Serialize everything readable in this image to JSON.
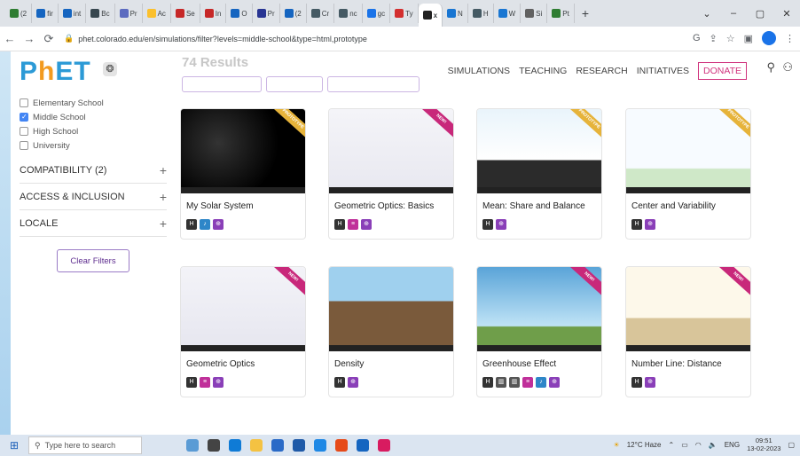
{
  "browser": {
    "tabs": [
      {
        "label": "(2",
        "color": "#2e7d32"
      },
      {
        "label": "fir",
        "color": "#1565c0"
      },
      {
        "label": "int",
        "color": "#1565c0"
      },
      {
        "label": "Bc",
        "color": "#37474f"
      },
      {
        "label": "Pr",
        "color": "#5c6bc0"
      },
      {
        "label": "Ac",
        "color": "#fbc02d"
      },
      {
        "label": "Se",
        "color": "#c62828"
      },
      {
        "label": "In",
        "color": "#c62828"
      },
      {
        "label": "O",
        "color": "#1565c0"
      },
      {
        "label": "Pr",
        "color": "#283593"
      },
      {
        "label": "(2",
        "color": "#1565c0"
      },
      {
        "label": "Cr",
        "color": "#455a64"
      },
      {
        "label": "nc",
        "color": "#455a64"
      },
      {
        "label": "gc",
        "color": "#1a73e8"
      },
      {
        "label": "Ty",
        "color": "#d32f2f"
      },
      {
        "label": "x",
        "color": "#212121",
        "active": true
      },
      {
        "label": "N",
        "color": "#1976d2"
      },
      {
        "label": "H",
        "color": "#455a64"
      },
      {
        "label": "W",
        "color": "#1976d2"
      },
      {
        "label": "Si",
        "color": "#616161"
      },
      {
        "label": "Pt",
        "color": "#2e7d32"
      }
    ],
    "new_tab": "+",
    "window_controls": [
      "⌄",
      "–",
      "▢",
      "✕"
    ],
    "url": "phet.colorado.edu/en/simulations/filter?levels=middle-school&type=html,prototype"
  },
  "header": {
    "logo_text": "PhET",
    "results_text": "74 Results",
    "nav": [
      "SIMULATIONS",
      "TEACHING",
      "RESEARCH",
      "INITIATIVES"
    ],
    "donate": "DONATE"
  },
  "sidebar": {
    "levels": [
      {
        "label": "Elementary School",
        "checked": false
      },
      {
        "label": "Middle School",
        "checked": true
      },
      {
        "label": "High School",
        "checked": false
      },
      {
        "label": "University",
        "checked": false
      }
    ],
    "facets": [
      {
        "label": "COMPATIBILITY (2)",
        "icon": "+"
      },
      {
        "label": "ACCESS & INCLUSION",
        "icon": "+"
      },
      {
        "label": "LOCALE",
        "icon": "+"
      }
    ],
    "clear_filters": "Clear Filters"
  },
  "cards": [
    {
      "title": "My Solar System",
      "ribbon": "PROTOTYPE",
      "icons": [
        "html",
        "sound",
        "zoom"
      ]
    },
    {
      "title": "Geometric Optics: Basics",
      "ribbon": "NEW!",
      "icons": [
        "html",
        "desc",
        "zoom"
      ]
    },
    {
      "title": "Mean: Share and Balance",
      "ribbon": "PROTOTYPE",
      "icons": [
        "html",
        "zoom"
      ]
    },
    {
      "title": "Center and Variability",
      "ribbon": "PROTOTYPE",
      "icons": [
        "html",
        "zoom"
      ]
    },
    {
      "title": "Geometric Optics",
      "ribbon": "NEW!",
      "icons": [
        "html",
        "desc",
        "zoom"
      ]
    },
    {
      "title": "Density",
      "ribbon": "",
      "icons": [
        "html",
        "zoom"
      ]
    },
    {
      "title": "Greenhouse Effect",
      "ribbon": "NEW!",
      "icons": [
        "html",
        "kb",
        "kb",
        "desc",
        "sound",
        "zoom"
      ]
    },
    {
      "title": "Number Line: Distance",
      "ribbon": "NEW!",
      "icons": [
        "html",
        "zoom"
      ]
    }
  ],
  "taskbar": {
    "search_placeholder": "Type here to search",
    "weather": "12°C  Haze",
    "lang": "ENG",
    "time": "09:51",
    "date": "13-02-2023"
  },
  "colors": {
    "accent": "#5e2d8f",
    "donate": "#d0337d",
    "logo_blue": "#2c9ad6",
    "logo_orange": "#f29a1f"
  }
}
